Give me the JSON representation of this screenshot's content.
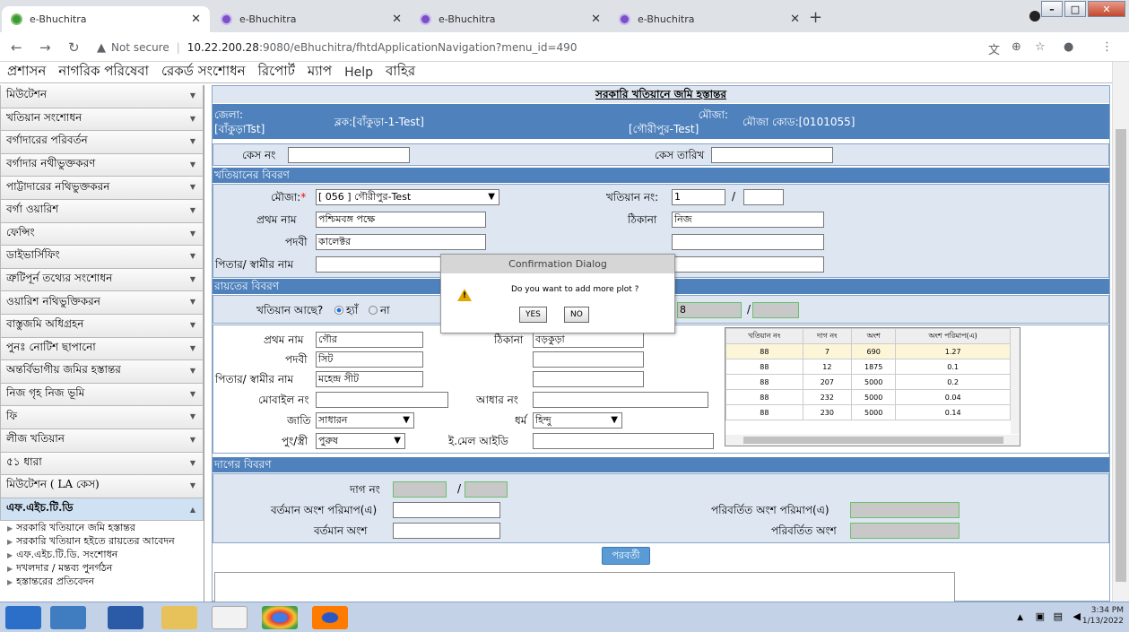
{
  "browser": {
    "tabs": [
      {
        "title": "e-Bhuchitra",
        "active": true
      },
      {
        "title": "e-Bhuchitra"
      },
      {
        "title": "e-Bhuchitra"
      },
      {
        "title": "e-Bhuchitra"
      }
    ],
    "security": "Not secure",
    "url_host": "10.22.200.28",
    "url_path": ":9080/eBhuchitra/fhtdApplicationNavigation?menu_id=490"
  },
  "menubar": [
    "প্রশাসন",
    "নাগরিক পরিষেবা",
    "রেকর্ড সংশোধন",
    "রিপোর্ট",
    "ম্যাপ",
    "Help",
    "বাহির"
  ],
  "sidebar": {
    "items": [
      "মিউটেশন",
      "খতিয়ান সংশোধন",
      "বর্গাদারের পরিবর্তন",
      "বর্গাদার নথীভুক্তকরণ",
      "পাট্টাদারের নথিভুক্তকরন",
      "বর্গা ওয়ারিশ",
      "ফেন্সিং",
      "ডাইভার্সিফিং",
      "ত্রুটিপূর্ন তথ্যের সংশোধন",
      "ওয়ারিশ নথিভুক্তিকরন",
      "বাস্তুজমি অধিগ্রহন",
      "পুনঃ নোটিশ ছাপানো",
      "অন্তর্বিভাগীয় জমির হস্তান্তর",
      "নিজ গৃহ নিজ ভূমি",
      "ফি",
      "লীজ খতিয়ান",
      "৫১ ধারা",
      "মিউটেশন ( LA কেস)"
    ],
    "selected": "এফ.এইচ.টি.ডি",
    "subitems": [
      "সরকারি খতিয়ানে জমি হস্তান্তর",
      "সরকারি খতিয়ান হইতে রায়তের আবেদন",
      "এফ.এইচ.টি.ডি. সংশোধন",
      "দখলদার / মন্তব্য পুনর্গঠন",
      "হস্তান্তরের প্রতিবেদন"
    ]
  },
  "form": {
    "title": "সরকারি খতিয়ানে জমি হস্তান্তর",
    "header": {
      "district_label": "জেলা:",
      "district_value": "[বাঁকুড়াTst]",
      "block": "ব্লক:[বাঁকুড়া-1-Test]",
      "mouza_label": "মৌজা:",
      "mouza_value": "[গৌরীপুর-Test]",
      "mouza_code": "মৌজা কোড:[0101055]"
    },
    "case_no_label": "কেস নং",
    "case_date_label": "কেস তারিখ",
    "khatian_section": "খতিয়ানের বিবরণ",
    "mouza_field_label": "মৌজা:",
    "mouza_select": "[ 056 ] গৌরীপুর-Test",
    "khatian_no_label": "খতিয়ান নং:",
    "khatian_no": "1",
    "slash": "/",
    "first_name_label": "প্রথম নাম",
    "first_name": "পশ্চিমবঙ্গ পক্ষে",
    "address_label": "ঠিকানা",
    "address": "নিজ",
    "title_label": "পদবী",
    "title_value": "কালেক্টর",
    "father_label": "পিতার/ স্বামীর নাম",
    "raiyat_section": "রায়তের বিবরণ",
    "has_khatian_label": "খতিয়ান আছে?",
    "yes": "হ্যাঁ",
    "no": "না",
    "raiyat_khatian_no": "8",
    "r_first_name": "গৌর",
    "r_address": "বড়কুড়া",
    "r_title": "সিট",
    "r_father": "মহেন্দ্র সীট",
    "mobile_label": "মোবাইল নং",
    "aadhaar_label": "আধার নং",
    "caste_label": "জাতি",
    "caste": "সাধারন",
    "religion_label": "ধর্ম",
    "religion": "হিন্দু",
    "gender_label": "পুং/স্ত্রী",
    "gender": "পুরুষ",
    "email_label": "ই.মেল আইডি",
    "plot_section": "দাগের বিবরণ",
    "plot_no_label": "দাগ নং",
    "cur_share_area_label": "বর্তমান অংশ পরিমাপ(এ)",
    "changed_share_area_label": "পরিবর্তিত অংশ পরিমাপ(এ)",
    "cur_share_label": "বর্তমান অংশ",
    "changed_share_label": "পরিবর্তিত অংশ",
    "next_button": "পরবর্তী"
  },
  "plot_table": {
    "headers": [
      "খতিয়ান নং",
      "দাগ নং",
      "অংশ",
      "অংশ পরিমাপ(এ)"
    ],
    "rows": [
      [
        "88",
        "7",
        "690",
        "1.27"
      ],
      [
        "88",
        "12",
        "1875",
        "0.1"
      ],
      [
        "88",
        "207",
        "5000",
        "0.2"
      ],
      [
        "88",
        "232",
        "5000",
        "0.04"
      ],
      [
        "88",
        "230",
        "5000",
        "0.14"
      ]
    ]
  },
  "dialog": {
    "title": "Confirmation Dialog",
    "message": "Do you want to add more plot ?",
    "yes": "YES",
    "no": "NO"
  },
  "taskbar": {
    "time": "3:34 PM",
    "date": "1/13/2022"
  }
}
